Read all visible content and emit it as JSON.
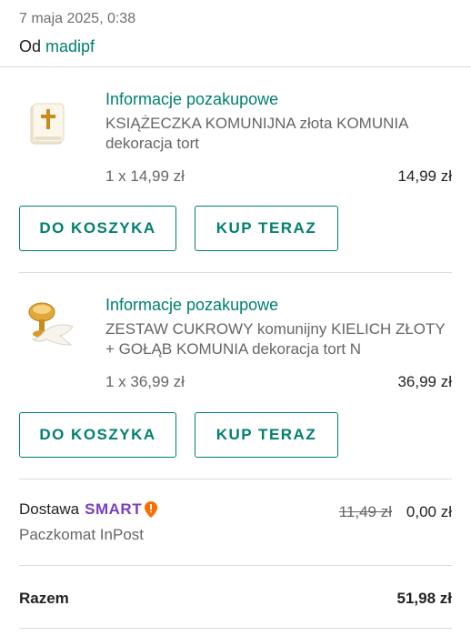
{
  "order": {
    "date": "7 maja 2025, 0:38",
    "seller_prefix": "Od",
    "seller_name": "madipf"
  },
  "items": [
    {
      "info_link": "Informacje pozakupowe",
      "title": "KSIĄŻECZKA KOMUNIJNA złota KOMUNIA dekoracja tort",
      "quantity_text": "1 x 14,99 zł",
      "price": "14,99 zł",
      "icon": "prayer-book-icon",
      "add_to_cart_label": "DO KOSZYKA",
      "buy_now_label": "KUP TERAZ"
    },
    {
      "info_link": "Informacje pozakupowe",
      "title": "ZESTAW CUKROWY komunijny KIELICH ZŁOTY + GOŁĄB KOMUNIA dekoracja tort N",
      "quantity_text": "1 x 36,99 zł",
      "price": "36,99 zł",
      "icon": "chalice-dove-icon",
      "add_to_cart_label": "DO KOSZYKA",
      "buy_now_label": "KUP TERAZ"
    }
  ],
  "shipping": {
    "label": "Dostawa",
    "badge": "SMART",
    "method": "Paczkomat InPost",
    "old_price": "11,49 zł",
    "price": "0,00 zł"
  },
  "total": {
    "label": "Razem",
    "value": "51,98 zł"
  },
  "colors": {
    "accent": "#00806f",
    "smart_purple": "#7a3fbf",
    "smart_orange": "#ff6a00"
  }
}
